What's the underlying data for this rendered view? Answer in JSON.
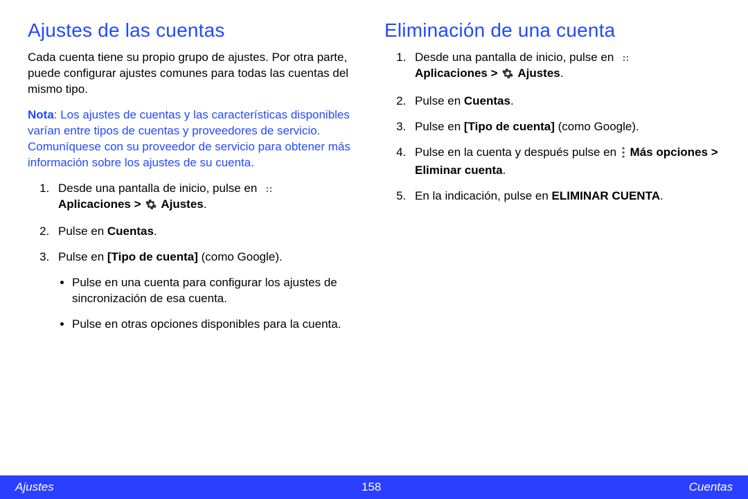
{
  "left": {
    "title": "Ajustes de las cuentas",
    "intro": "Cada cuenta tiene su propio grupo de ajustes. Por otra parte, puede configurar ajustes comunes para todas las cuentas del mismo tipo.",
    "note_label": "Nota",
    "note_body": ": Los ajustes de cuentas y las características disponibles varían entre tipos de cuentas y proveedores de servicio. Comuníquese con su proveedor de servicio para obtener más información sobre los ajustes de su cuenta.",
    "step1_pre": "Desde una pantalla de inicio, pulse en ",
    "step1_apps_b": "Aplicaciones > ",
    "step1_settings_b": " Ajustes",
    "step2_pre": "Pulse en ",
    "step2_b": "Cuentas",
    "step3_pre": "Pulse en ",
    "step3_b": "[Tipo de cuenta]",
    "step3_post": " (como Google).",
    "bullet1": "Pulse en una cuenta para configurar los ajustes de sincronización de esa cuenta.",
    "bullet2": "Pulse en otras opciones disponibles para la cuenta."
  },
  "right": {
    "title": "Eliminación de una cuenta",
    "step1_pre": "Desde una pantalla de inicio, pulse en ",
    "step1_apps_b": "Aplicaciones > ",
    "step1_settings_b": " Ajustes",
    "step2_pre": "Pulse en ",
    "step2_b": "Cuentas",
    "step3_pre": "Pulse en ",
    "step3_b": "[Tipo de cuenta]",
    "step3_post": " (como Google).",
    "step4_pre": "Pulse en la cuenta y después pulse en ",
    "step4_b": " Más opciones > Eliminar cuenta",
    "step5_pre": "En la indicación, pulse en ",
    "step5_b": "ELIMINAR CUENTA"
  },
  "footer": {
    "left": "Ajustes",
    "center": "158",
    "right": "Cuentas"
  },
  "icons": {
    "apps": "apps-grid-icon",
    "gear": "gear-icon",
    "more": "more-vertical-icon"
  }
}
